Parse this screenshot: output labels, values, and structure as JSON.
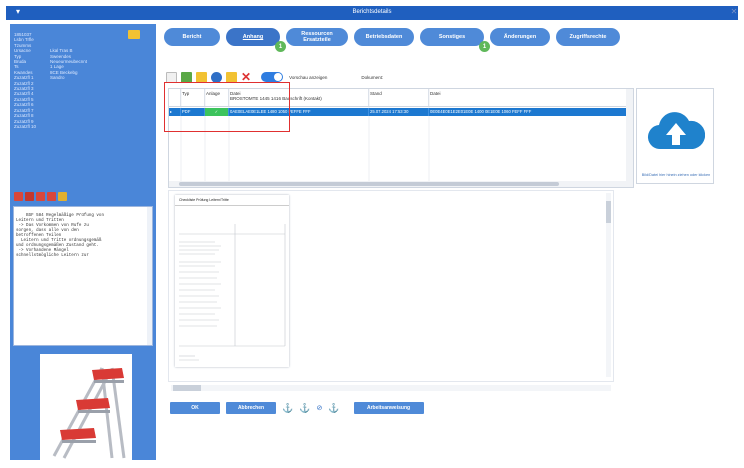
{
  "window": {
    "title": "Berichtsdetails",
    "min_icon": "menu-icon",
    "close_icon": "close-icon"
  },
  "sidebar": {
    "info_rows": [
      {
        "k": "1851037",
        "v": ""
      },
      {
        "k": "Lsbn Trfle Tzumms",
        "v": ""
      },
      {
        "k": "Ursacne",
        "v": "Lkal Tras B"
      },
      {
        "k": "Typ",
        "v": "Sweendes"
      },
      {
        "k": "Bruda",
        "v": "Neueurmeubecnnt"
      },
      {
        "k": "Ts",
        "v": "1 Lage"
      },
      {
        "k": "Kwandes",
        "v": "8CE Beckebg"
      },
      {
        "k": "Zuzatzfl 1",
        "v": "Sandro"
      },
      {
        "k": "Zuzatzfl 2",
        "v": ""
      },
      {
        "k": "Zuzatzfl 3",
        "v": ""
      },
      {
        "k": "Zuzatzfl 4",
        "v": ""
      },
      {
        "k": "Zuzatzfl 5",
        "v": ""
      },
      {
        "k": "Zuzatzfl 6",
        "v": ""
      },
      {
        "k": "Zuzatzfl 7",
        "v": ""
      },
      {
        "k": "Zuzatzfl 8",
        "v": ""
      },
      {
        "k": "Zuzatzfl 9",
        "v": ""
      },
      {
        "k": "Zuzatzfl 10",
        "v": ""
      }
    ],
    "notes": "BSF 584 Regelmäßige Prüfung von\nLeitern und Tritten\n -> Das Vorkommen von Rufe zu\nsorgen, dass alle von den\nbetroffenen Teilen\n  Leitern und Tritte ordnungsgemäß\nund ordnungsgemäßen Zustand geht.\n -> Vorhandene Mängel\nschnellstmögliche Leitern zur"
  },
  "tabs": [
    {
      "label": "Bericht",
      "badge": ""
    },
    {
      "label": "Anhang",
      "badge": "1",
      "active": true
    },
    {
      "label": "Ressourcen Ersatzteile",
      "badge": ""
    },
    {
      "label": "Betriebsdaten",
      "badge": ""
    },
    {
      "label": "Sonstiges",
      "badge": "1"
    },
    {
      "label": "Änderungen",
      "badge": ""
    },
    {
      "label": "Zugriffsrechte",
      "badge": ""
    }
  ],
  "toolbar": {
    "toggle_label": "Vorschau anzeigen",
    "doc_label": "Dokument:"
  },
  "grid": {
    "columns": [
      "Typ",
      "Anlage",
      "Datei",
      "Stand",
      "Datei"
    ],
    "header_sub": "BROSTOMTE 1445 1416 Bauschrift (Kontakt)",
    "selected_row": [
      "PDF",
      "✓",
      "0AE0ELAE0E1LEE 1480 1050 FEFFE FFF",
      "25.07.2024 17:53:30",
      "0E0E4E0E1E2E01E0E 1400 0E1E0E 1060 FEFF FFF"
    ]
  },
  "upload": {
    "caption": "Bild/Datei hier hinein ziehen oder klicken"
  },
  "preview": {
    "page_title": "Checkliste Prüfung Leitern/Tritte"
  },
  "buttons": {
    "ok": "OK",
    "cancel": "Abbrechen",
    "workflow": "Arbeitsanweisung"
  }
}
